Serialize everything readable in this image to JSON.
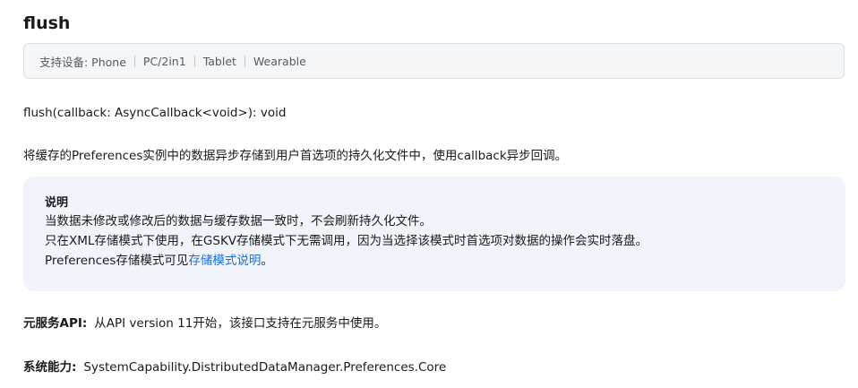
{
  "heading": "flush",
  "devices": {
    "label": "支持设备: Phone",
    "items": [
      "PC/2in1",
      "Tablet",
      "Wearable"
    ]
  },
  "signature": "flush(callback: AsyncCallback<void>): void",
  "description": "将缓存的Preferences实例中的数据异步存储到用户首选项的持久化文件中，使用callback异步回调。",
  "note": {
    "title": "说明",
    "line1": "当数据未修改或修改后的数据与缓存数据一致时，不会刷新持久化文件。",
    "line2": "只在XML存储模式下使用，在GSKV存储模式下无需调用，因为当选择该模式时首选项对数据的操作会实时落盘。",
    "line3_prefix": "Preferences存储模式可见",
    "line3_link": "存储模式说明",
    "line3_suffix": "。"
  },
  "meta": {
    "atomic_label": "元服务API:",
    "atomic_value": "从API version 11开始，该接口支持在元服务中使用。",
    "syscap_label": "系统能力:",
    "syscap_value": "SystemCapability.DistributedDataManager.Preferences.Core"
  },
  "colors": {
    "link": "#1a6fe0",
    "note_bg": "#f1f4fb",
    "devices_bg": "#f5f6f7"
  }
}
